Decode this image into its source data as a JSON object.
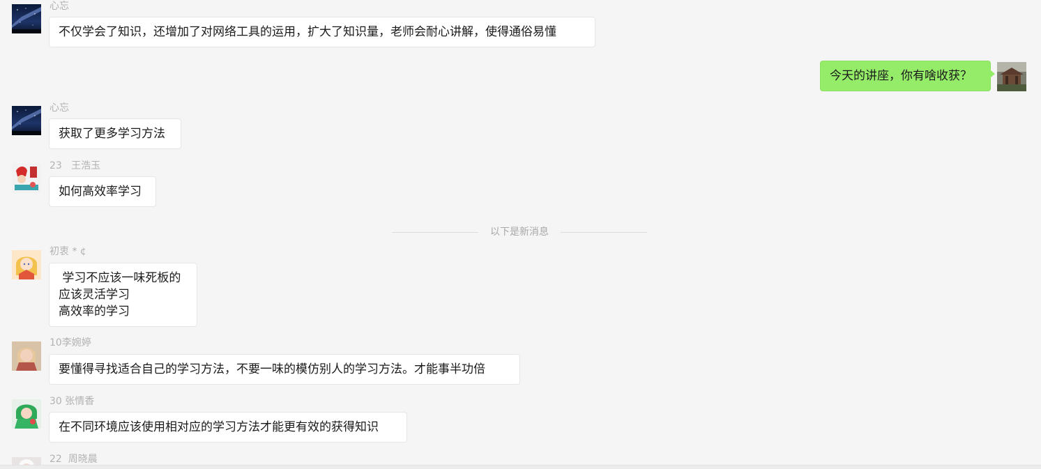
{
  "divider": {
    "label": "以下是新消息"
  },
  "messages": [
    {
      "sender": "心忘",
      "avatar": "starry-night-avatar",
      "lines": [
        "不仅学会了知识，还增加了对网络工具的运用，扩大了知识量，老师会耐心讲解，使得通俗易懂"
      ]
    },
    {
      "sender": "",
      "avatar": "pavilion-photo-avatar",
      "mine": true,
      "lines": [
        "今天的讲座，你有啥收获？"
      ]
    },
    {
      "sender": "心忘",
      "avatar": "starry-night-avatar",
      "lines": [
        "获取了更多学习方法"
      ]
    },
    {
      "sender": "23   王浩玉",
      "avatar": "red-hat-character-avatar",
      "lines": [
        "如何高效率学习"
      ]
    },
    {
      "sender": "初衷 * ¢",
      "avatar": "anime-girl-avatar",
      "lines": [
        " 学习不应该一味死板的",
        "应该灵活学习",
        "高效率的学习"
      ]
    },
    {
      "sender": "10李婉婷",
      "avatar": "child-photo-avatar",
      "lines": [
        "要懂得寻找适合自己的学习方法，不要一味的模仿别人的学习方法。才能事半功倍"
      ]
    },
    {
      "sender": "30 张情香",
      "avatar": "green-cartoon-avatar",
      "lines": [
        "在不同环境应该使用相对应的学习方法才能更有效的获得知识"
      ]
    },
    {
      "sender": "22  周晓晨",
      "avatar": "white-figure-avatar",
      "lines": []
    }
  ]
}
